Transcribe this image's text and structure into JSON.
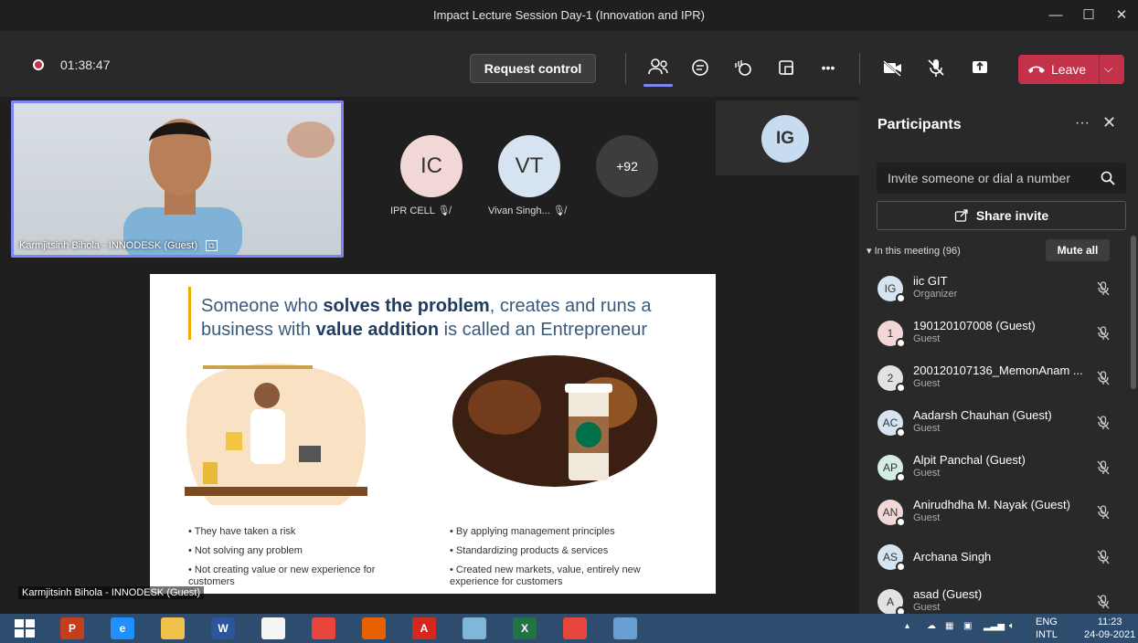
{
  "window": {
    "title": "Impact Lecture Session Day-1 (Innovation and IPR)",
    "minimize": "—",
    "maximize": "☐",
    "close": "✕"
  },
  "toolbar": {
    "timer": "01:38:47",
    "request_control": "Request control",
    "leave": "Leave",
    "leave_chevron": "⌵",
    "more": "•••"
  },
  "stage": {
    "self_video_caption": "Karmjitsinh Bihola - INNODESK (Guest)",
    "tiles": [
      {
        "initials": "IC",
        "caption": "IPR CELL",
        "color": "#f2d7d7"
      },
      {
        "initials": "VT",
        "caption": "Vivan Singh...",
        "color": "#d6e3f0"
      }
    ],
    "overflow": "+92",
    "ig_tile": "IG",
    "slide": {
      "heading_1": "Someone who ",
      "heading_2": "solves the problem",
      "heading_3": ", creates and runs a business with ",
      "heading_4": "value addition",
      "heading_5": " is called an Entrepreneur",
      "left_bullets": [
        "They have taken a risk",
        "Not solving any problem",
        "Not creating value or new experience for customers"
      ],
      "right_bullets": [
        "By applying management principles",
        "Standardizing products & services",
        "Created new markets, value, entirely new experience for customers"
      ]
    },
    "presenter_caption": "Karmjitsinh Bihola - INNODESK (Guest)"
  },
  "panel": {
    "title": "Participants",
    "more": "···",
    "close": "✕",
    "invite_placeholder": "Invite someone or dial a number",
    "share_invite": "Share invite",
    "section_label": "▾ In this meeting (96)",
    "mute_all": "Mute all",
    "participants": [
      {
        "initials": "IG",
        "name": "iic GIT",
        "role": "Organizer",
        "color": "#d6e3f0"
      },
      {
        "initials": "1",
        "name": "190120107008 (Guest)",
        "role": "Guest",
        "color": "#f2d7d7"
      },
      {
        "initials": "2",
        "name": "200120107136_MemonAnam ...",
        "role": "Guest",
        "color": "#e2e2e2"
      },
      {
        "initials": "AC",
        "name": "Aadarsh Chauhan (Guest)",
        "role": "Guest",
        "color": "#d6e3f0"
      },
      {
        "initials": "AP",
        "name": "Alpit Panchal (Guest)",
        "role": "Guest",
        "color": "#d3ede6"
      },
      {
        "initials": "AN",
        "name": "Anirudhdha M. Nayak (Guest)",
        "role": "Guest",
        "color": "#f2d7d7"
      },
      {
        "initials": "AS",
        "name": "Archana Singh",
        "role": "",
        "color": "#d6e3f0"
      },
      {
        "initials": "A",
        "name": "asad (Guest)",
        "role": "Guest",
        "color": "#e2e2e2"
      }
    ]
  },
  "taskbar": {
    "apps": [
      {
        "name": "powerpoint",
        "label": "P",
        "color": "#c43e1c"
      },
      {
        "name": "edge",
        "label": "e",
        "color": "#1e90ff"
      },
      {
        "name": "explorer",
        "label": "",
        "color": "#f0c24b"
      },
      {
        "name": "word",
        "label": "W",
        "color": "#2b579a"
      },
      {
        "name": "blank",
        "label": "",
        "color": "#f5f5f5"
      },
      {
        "name": "chrome",
        "label": "",
        "color": "#e8453c"
      },
      {
        "name": "firefox",
        "label": "",
        "color": "#e66000"
      },
      {
        "name": "acrobat",
        "label": "A",
        "color": "#d4281e"
      },
      {
        "name": "notes",
        "label": "",
        "color": "#7fb6d9"
      },
      {
        "name": "excel",
        "label": "X",
        "color": "#217346"
      },
      {
        "name": "chrome-2",
        "label": "",
        "color": "#e8453c"
      },
      {
        "name": "paint",
        "label": "",
        "color": "#6a9fd4"
      }
    ],
    "lang_1": "ENG",
    "lang_2": "INTL",
    "time": "11:23",
    "date": "24-09-2021"
  }
}
